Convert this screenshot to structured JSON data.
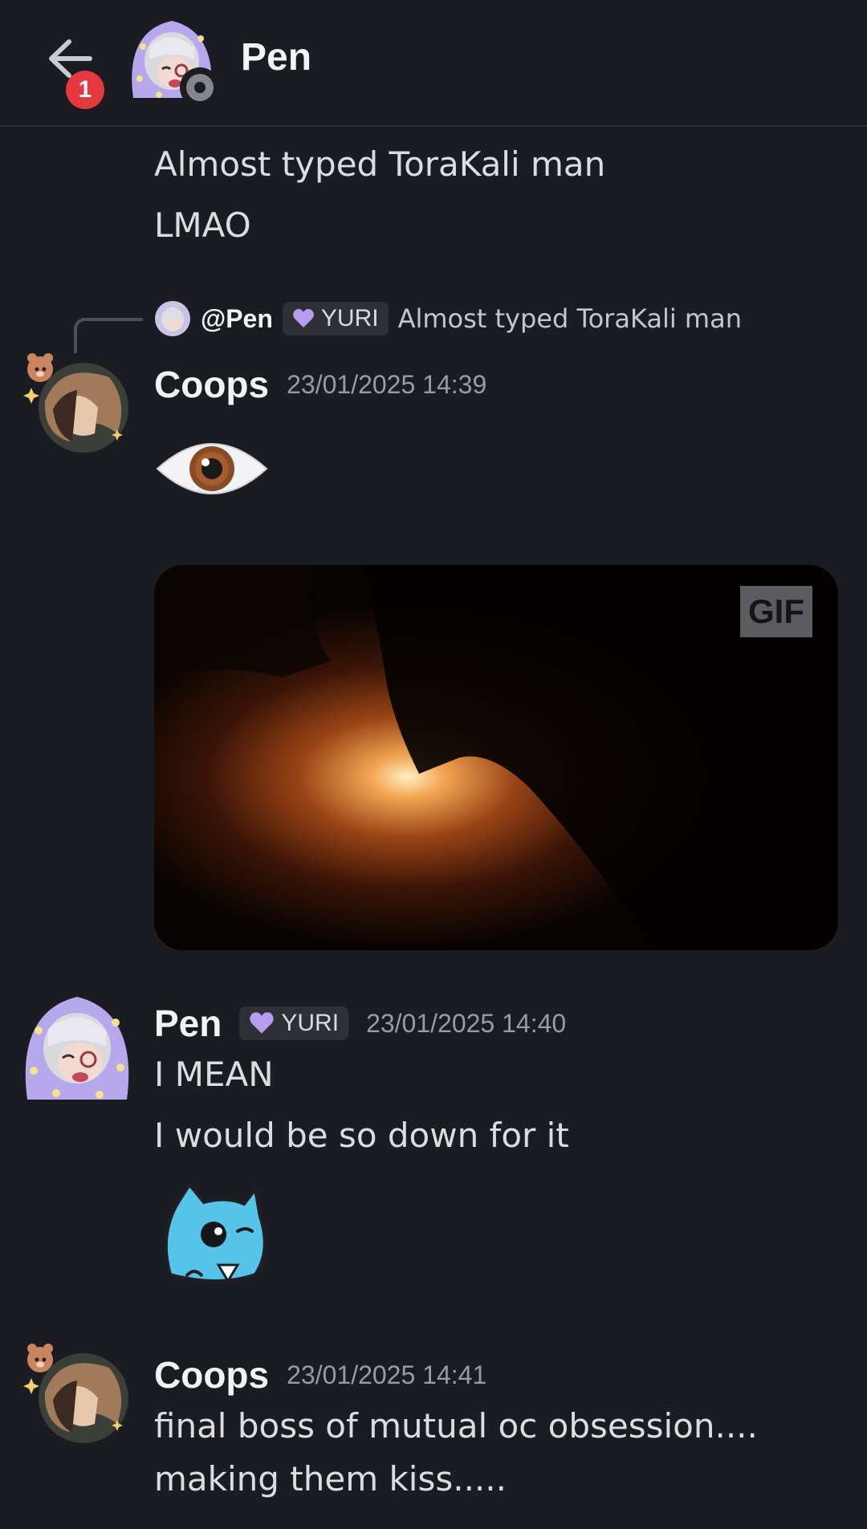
{
  "header": {
    "title": "Pen",
    "notification_count": "1"
  },
  "messages": {
    "pen_top_line1": "Almost typed ToraKali man",
    "pen_top_line2": "LMAO",
    "reply": {
      "mention": "@Pen",
      "role": "YURI",
      "text": "Almost typed ToraKali man"
    },
    "coops1": {
      "author": "Coops",
      "timestamp": "23/01/2025 14:39",
      "emoji_icon": "eye-emoji",
      "gif_badge": "GIF"
    },
    "pen2": {
      "author": "Pen",
      "role": "YURI",
      "timestamp": "23/01/2025 14:40",
      "line1": "I MEAN",
      "line2": "I would be so down for it",
      "sticker_icon": "blue-cat-wink-sticker"
    },
    "coops2": {
      "author": "Coops",
      "timestamp": "23/01/2025 14:41",
      "line1": "final boss of mutual oc obsession....",
      "line2": "making them kiss....."
    }
  },
  "colors": {
    "background": "#1b1c21",
    "badge": "#e5383f",
    "role_heart": "#b89cf0"
  }
}
